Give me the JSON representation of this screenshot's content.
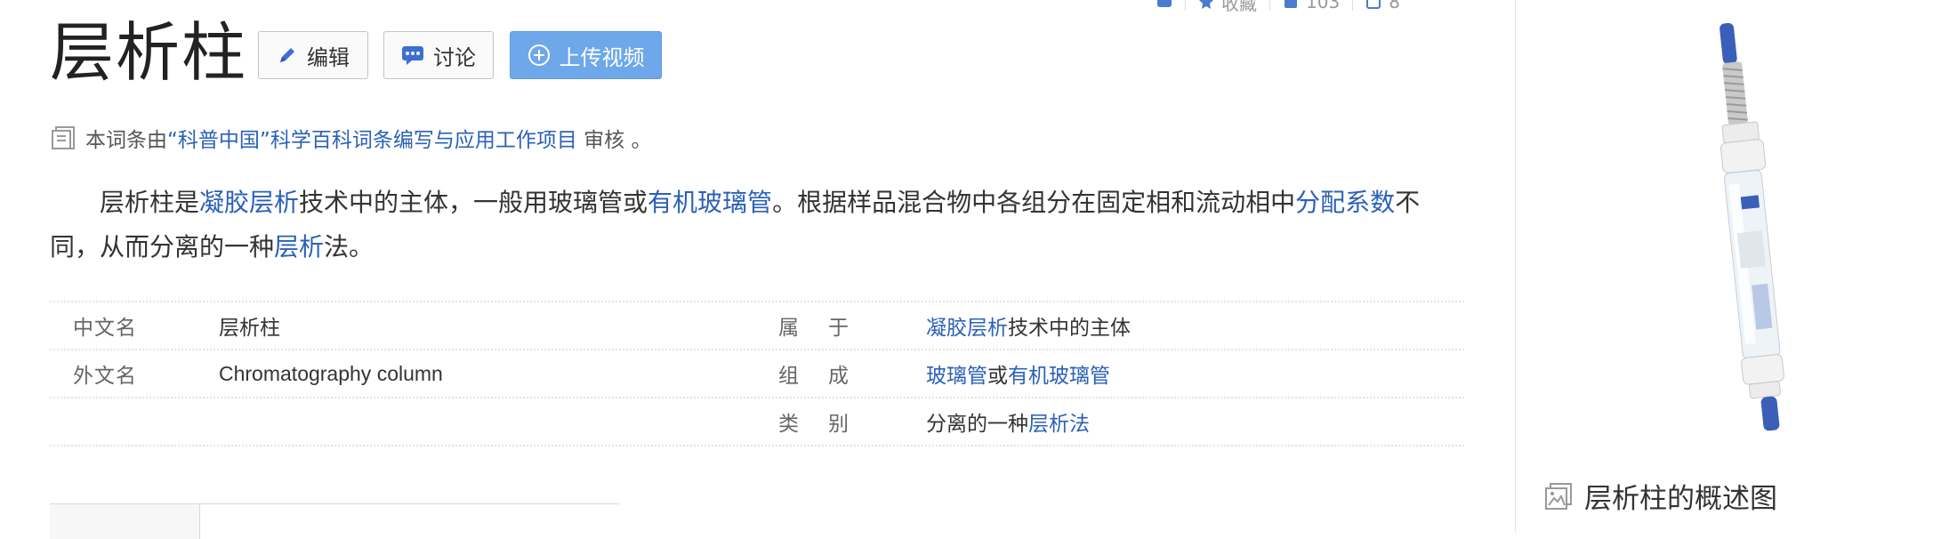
{
  "topbar": {
    "favorite_label": "收藏",
    "like_count": "103",
    "share_count": "8"
  },
  "title": "层析柱",
  "buttons": {
    "edit": "编辑",
    "discuss": "讨论",
    "upload_video": "上传视频"
  },
  "audit": {
    "prefix": "本词条由",
    "link": "“科普中国”科学百科词条编写与应用工作项目",
    "suffix": " 审核 。"
  },
  "intro": {
    "t1": "层析柱是",
    "l1": "凝胶层析",
    "t2": "技术中的主体，一般用玻璃管或",
    "l2": "有机玻璃管",
    "t3": "。根据样品混合物中各组分在固定相和流动相中",
    "l3": "分配系数",
    "t4": "不同，从而分离的一种",
    "l4": "层析",
    "t5": "法。"
  },
  "info": {
    "rows": [
      {
        "name": "中文名",
        "value": "层析柱",
        "name2a": "属",
        "name2b": "于",
        "val2_link": "凝胶层析",
        "val2_text": "技术中的主体",
        "val2_link2": ""
      },
      {
        "name": "外文名",
        "value": "Chromatography column",
        "name2a": "组",
        "name2b": "成",
        "val2_link": "玻璃管",
        "val2_text": "或",
        "val2_link2": "有机玻璃管"
      },
      {
        "name": "",
        "value": "",
        "name2a": "类",
        "name2b": "别",
        "val2_prefix": "分离的一种",
        "val2_link": "层析法"
      }
    ]
  },
  "sidebar": {
    "caption": "层析柱的概述图"
  },
  "colors": {
    "link": "#2b61b6",
    "upload_button": "#6ea7ea"
  }
}
